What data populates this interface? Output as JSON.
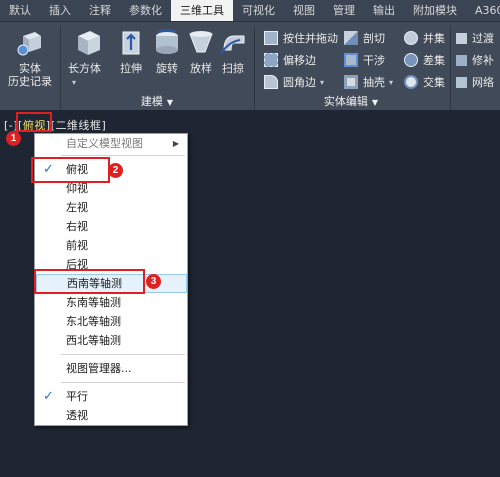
{
  "tabs": [
    "默认",
    "插入",
    "注释",
    "参数化",
    "三维工具",
    "可视化",
    "视图",
    "管理",
    "输出",
    "附加模块",
    "A360"
  ],
  "active_tab": "三维工具",
  "ribbon": {
    "history": {
      "line1": "实体",
      "line2": "历史记录"
    },
    "modeling_buttons": [
      "长方体",
      "拉伸",
      "旋转",
      "放样",
      "扫掠"
    ],
    "box_dropdown": "▾",
    "modeling_panel": "建模",
    "edit_items": [
      {
        "label": "按住并拖动",
        "icon": "presspull-icon"
      },
      {
        "label": "偏移边",
        "icon": "offset-edge-icon"
      },
      {
        "label": "圆角边",
        "icon": "fillet-edge-icon"
      },
      {
        "label": "剖切",
        "icon": "slice-icon"
      },
      {
        "label": "干涉",
        "icon": "interfere-icon"
      },
      {
        "label": "抽壳",
        "icon": "shell-icon"
      },
      {
        "label": "并集",
        "icon": "union-icon"
      },
      {
        "label": "差集",
        "icon": "subtract-icon"
      },
      {
        "label": "交集",
        "icon": "intersect-icon"
      }
    ],
    "solid_edit_panel": "实体编辑",
    "right_items": [
      "过渡",
      "修补",
      "网络"
    ]
  },
  "viewport_label": {
    "prefix": "[-][",
    "view": "俯视",
    "middle": "][",
    "style": "二维线框",
    "suffix": "]"
  },
  "menu": {
    "custom_view": "自定义模型视图",
    "views": [
      "俯视",
      "仰视",
      "左视",
      "右视",
      "前视",
      "后视",
      "西南等轴测",
      "东南等轴测",
      "东北等轴测",
      "西北等轴测"
    ],
    "checked_view": "俯视",
    "view_manager": "视图管理器...",
    "parallel": "平行",
    "perspective": "透视"
  },
  "badges": [
    "1",
    "2",
    "3"
  ],
  "colors": {
    "accent_red": "#e02020",
    "check_blue": "#2b6ed6",
    "highlight_yellow": "#f2e36a"
  }
}
